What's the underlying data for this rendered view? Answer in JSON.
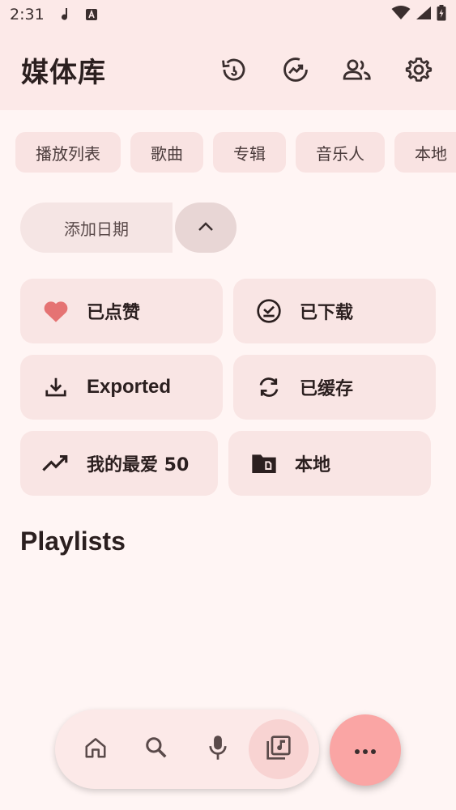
{
  "status_bar": {
    "time": "2:31",
    "icons": [
      "music-note-icon",
      "keyboard-a-icon",
      "wifi-icon",
      "signal-icon",
      "battery-icon"
    ]
  },
  "header": {
    "title": "媒体库",
    "actions": [
      "history-icon",
      "trending-icon",
      "people-icon",
      "settings-icon"
    ]
  },
  "filter_chips": [
    "播放列表",
    "歌曲",
    "专辑",
    "音乐人",
    "本地"
  ],
  "sort": {
    "label": "添加日期",
    "direction_icon": "chevron-up-icon"
  },
  "cards": [
    {
      "label": "已点赞",
      "icon": "heart-icon"
    },
    {
      "label": "已下载",
      "icon": "download-check-icon"
    },
    {
      "label": "Exported",
      "icon": "download-icon"
    },
    {
      "label": "已缓存",
      "icon": "sync-icon"
    },
    {
      "label": "我的最爱 50",
      "icon": "trending-up-icon"
    },
    {
      "label": "本地",
      "icon": "local-folder-icon"
    }
  ],
  "section": {
    "title": "Playlists"
  },
  "bottom_nav": {
    "items": [
      "home-icon",
      "search-icon",
      "mic-icon",
      "library-music-icon"
    ],
    "active": "library-music-icon"
  },
  "fab": {
    "icon": "more-horiz-icon"
  },
  "colors": {
    "background": "#FFF5F4",
    "topbar": "#FCE9E8",
    "card": "#F9E5E4",
    "accent_heart": "#E57373",
    "fab": "#FAA5A4"
  }
}
